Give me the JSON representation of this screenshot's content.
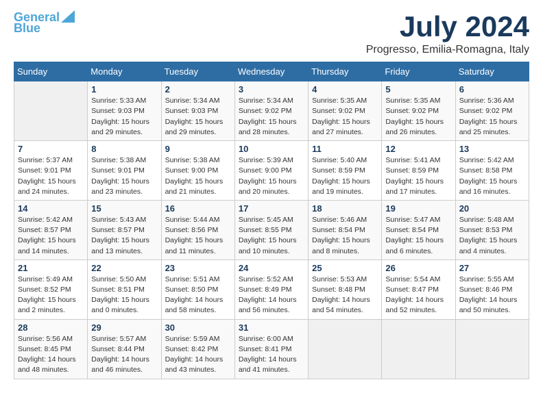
{
  "header": {
    "logo_line1": "General",
    "logo_line2": "Blue",
    "month_year": "July 2024",
    "location": "Progresso, Emilia-Romagna, Italy"
  },
  "days_of_week": [
    "Sunday",
    "Monday",
    "Tuesday",
    "Wednesday",
    "Thursday",
    "Friday",
    "Saturday"
  ],
  "weeks": [
    [
      {
        "num": "",
        "info": ""
      },
      {
        "num": "1",
        "info": "Sunrise: 5:33 AM\nSunset: 9:03 PM\nDaylight: 15 hours\nand 29 minutes."
      },
      {
        "num": "2",
        "info": "Sunrise: 5:34 AM\nSunset: 9:03 PM\nDaylight: 15 hours\nand 29 minutes."
      },
      {
        "num": "3",
        "info": "Sunrise: 5:34 AM\nSunset: 9:02 PM\nDaylight: 15 hours\nand 28 minutes."
      },
      {
        "num": "4",
        "info": "Sunrise: 5:35 AM\nSunset: 9:02 PM\nDaylight: 15 hours\nand 27 minutes."
      },
      {
        "num": "5",
        "info": "Sunrise: 5:35 AM\nSunset: 9:02 PM\nDaylight: 15 hours\nand 26 minutes."
      },
      {
        "num": "6",
        "info": "Sunrise: 5:36 AM\nSunset: 9:02 PM\nDaylight: 15 hours\nand 25 minutes."
      }
    ],
    [
      {
        "num": "7",
        "info": "Sunrise: 5:37 AM\nSunset: 9:01 PM\nDaylight: 15 hours\nand 24 minutes."
      },
      {
        "num": "8",
        "info": "Sunrise: 5:38 AM\nSunset: 9:01 PM\nDaylight: 15 hours\nand 23 minutes."
      },
      {
        "num": "9",
        "info": "Sunrise: 5:38 AM\nSunset: 9:00 PM\nDaylight: 15 hours\nand 21 minutes."
      },
      {
        "num": "10",
        "info": "Sunrise: 5:39 AM\nSunset: 9:00 PM\nDaylight: 15 hours\nand 20 minutes."
      },
      {
        "num": "11",
        "info": "Sunrise: 5:40 AM\nSunset: 8:59 PM\nDaylight: 15 hours\nand 19 minutes."
      },
      {
        "num": "12",
        "info": "Sunrise: 5:41 AM\nSunset: 8:59 PM\nDaylight: 15 hours\nand 17 minutes."
      },
      {
        "num": "13",
        "info": "Sunrise: 5:42 AM\nSunset: 8:58 PM\nDaylight: 15 hours\nand 16 minutes."
      }
    ],
    [
      {
        "num": "14",
        "info": "Sunrise: 5:42 AM\nSunset: 8:57 PM\nDaylight: 15 hours\nand 14 minutes."
      },
      {
        "num": "15",
        "info": "Sunrise: 5:43 AM\nSunset: 8:57 PM\nDaylight: 15 hours\nand 13 minutes."
      },
      {
        "num": "16",
        "info": "Sunrise: 5:44 AM\nSunset: 8:56 PM\nDaylight: 15 hours\nand 11 minutes."
      },
      {
        "num": "17",
        "info": "Sunrise: 5:45 AM\nSunset: 8:55 PM\nDaylight: 15 hours\nand 10 minutes."
      },
      {
        "num": "18",
        "info": "Sunrise: 5:46 AM\nSunset: 8:54 PM\nDaylight: 15 hours\nand 8 minutes."
      },
      {
        "num": "19",
        "info": "Sunrise: 5:47 AM\nSunset: 8:54 PM\nDaylight: 15 hours\nand 6 minutes."
      },
      {
        "num": "20",
        "info": "Sunrise: 5:48 AM\nSunset: 8:53 PM\nDaylight: 15 hours\nand 4 minutes."
      }
    ],
    [
      {
        "num": "21",
        "info": "Sunrise: 5:49 AM\nSunset: 8:52 PM\nDaylight: 15 hours\nand 2 minutes."
      },
      {
        "num": "22",
        "info": "Sunrise: 5:50 AM\nSunset: 8:51 PM\nDaylight: 15 hours\nand 0 minutes."
      },
      {
        "num": "23",
        "info": "Sunrise: 5:51 AM\nSunset: 8:50 PM\nDaylight: 14 hours\nand 58 minutes."
      },
      {
        "num": "24",
        "info": "Sunrise: 5:52 AM\nSunset: 8:49 PM\nDaylight: 14 hours\nand 56 minutes."
      },
      {
        "num": "25",
        "info": "Sunrise: 5:53 AM\nSunset: 8:48 PM\nDaylight: 14 hours\nand 54 minutes."
      },
      {
        "num": "26",
        "info": "Sunrise: 5:54 AM\nSunset: 8:47 PM\nDaylight: 14 hours\nand 52 minutes."
      },
      {
        "num": "27",
        "info": "Sunrise: 5:55 AM\nSunset: 8:46 PM\nDaylight: 14 hours\nand 50 minutes."
      }
    ],
    [
      {
        "num": "28",
        "info": "Sunrise: 5:56 AM\nSunset: 8:45 PM\nDaylight: 14 hours\nand 48 minutes."
      },
      {
        "num": "29",
        "info": "Sunrise: 5:57 AM\nSunset: 8:44 PM\nDaylight: 14 hours\nand 46 minutes."
      },
      {
        "num": "30",
        "info": "Sunrise: 5:59 AM\nSunset: 8:42 PM\nDaylight: 14 hours\nand 43 minutes."
      },
      {
        "num": "31",
        "info": "Sunrise: 6:00 AM\nSunset: 8:41 PM\nDaylight: 14 hours\nand 41 minutes."
      },
      {
        "num": "",
        "info": ""
      },
      {
        "num": "",
        "info": ""
      },
      {
        "num": "",
        "info": ""
      }
    ]
  ]
}
